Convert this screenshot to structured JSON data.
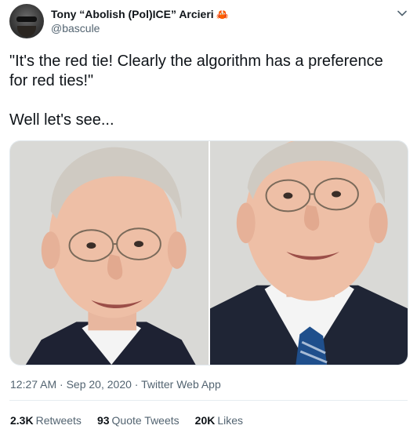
{
  "author": {
    "display_name": "Tony “Abolish (Pol)ICE” Arcieri",
    "handle": "@bascule",
    "badge_emoji": "🦀"
  },
  "tweet": {
    "paragraph_1": "\"It's the red tie! Clearly the algorithm has a preference for red ties!\"",
    "paragraph_2": "Well let's see..."
  },
  "meta": {
    "timestamp": "12:27 AM · Sep 20, 2020 · Twitter Web App"
  },
  "stats": {
    "retweets_count": "2.3K",
    "retweets_label": "Retweets",
    "quote_count": "93",
    "quote_label": "Quote Tweets",
    "likes_count": "20K",
    "likes_label": "Likes"
  },
  "colors": {
    "text_primary": "#0f1419",
    "text_secondary": "#536471",
    "divider": "#e6ecf0"
  },
  "icons": [
    "avatar",
    "crab-icon",
    "chevron-down-icon"
  ]
}
